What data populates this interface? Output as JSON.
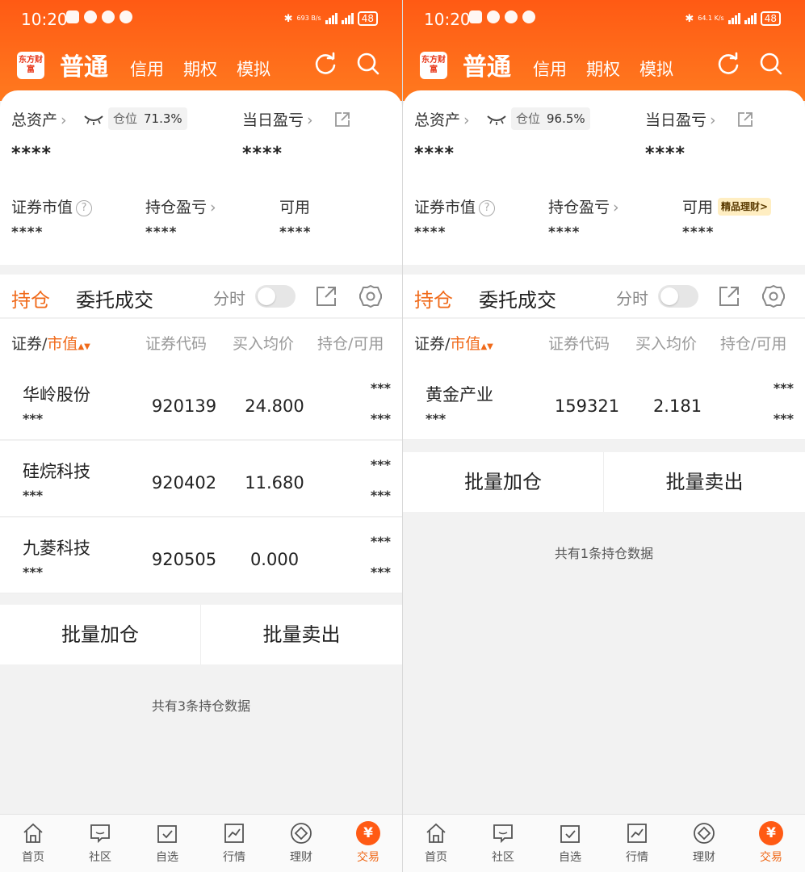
{
  "status": {
    "left_time": "10:20",
    "left_net": "693 B/s",
    "right_time": "10:20",
    "right_net": "64.1 K/s",
    "battery": "48"
  },
  "nav": {
    "logo": "东方财富",
    "main": "普通",
    "tabs": [
      "信用",
      "期权",
      "模拟"
    ]
  },
  "summary": {
    "total_assets_label": "总资产",
    "position_label": "仓位",
    "left_position_value": "71.3%",
    "right_position_value": "96.5%",
    "daily_pnl_label": "当日盈亏",
    "masked_big": "****",
    "masked_small": "****",
    "market_value_label": "证券市值",
    "holding_pnl_label": "持仓盈亏",
    "available_label": "可用",
    "finance_badge": "精品理财>"
  },
  "section": {
    "tab_holdings": "持仓",
    "tab_orders": "委托成交",
    "fenshi": "分时"
  },
  "table_headers": {
    "security": "证券",
    "market_value": "市值",
    "code": "证券代码",
    "avg_price": "买入均价",
    "hold_avail": "持仓/可用"
  },
  "left_rows": [
    {
      "name": "华岭股份",
      "sub": "***",
      "code": "920139",
      "price": "24.800",
      "s1": "***",
      "s2": "***"
    },
    {
      "name": "硅烷科技",
      "sub": "***",
      "code": "920402",
      "price": "11.680",
      "s1": "***",
      "s2": "***"
    },
    {
      "name": "九菱科技",
      "sub": "***",
      "code": "920505",
      "price": "0.000",
      "s1": "***",
      "s2": "***"
    }
  ],
  "right_rows": [
    {
      "name": "黄金产业",
      "sub": "***",
      "code": "159321",
      "price": "2.181",
      "s1": "***",
      "s2": "***"
    }
  ],
  "batch": {
    "add": "批量加仓",
    "sell": "批量卖出"
  },
  "left_count": "共有3条持仓数据",
  "right_count": "共有1条持仓数据",
  "bottom_nav": [
    "首页",
    "社区",
    "自选",
    "行情",
    "理财",
    "交易"
  ],
  "bottom_nav_active_icon": "¥",
  "colors": {
    "accent": "#f06a1a",
    "header": "#ff5a14"
  }
}
